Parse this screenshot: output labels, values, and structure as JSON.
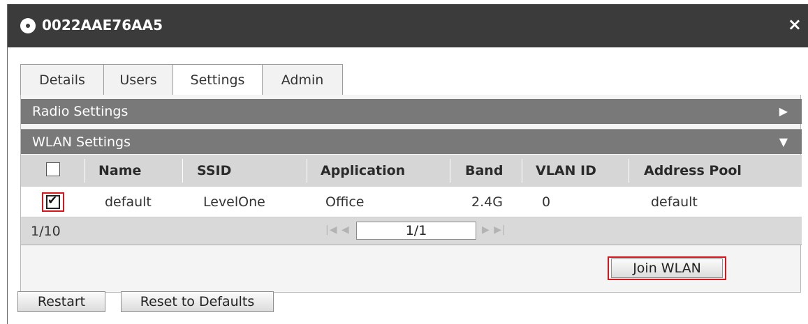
{
  "window": {
    "title": "0022AAE76AA5",
    "icon": "wireless-ap-icon",
    "close_glyph": "×"
  },
  "tabs": [
    {
      "label": "Details"
    },
    {
      "label": "Users"
    },
    {
      "label": "Settings",
      "active": true
    },
    {
      "label": "Admin"
    }
  ],
  "sections": {
    "radio": {
      "label": "Radio Settings",
      "arrow": "▶",
      "expanded": false
    },
    "wlan": {
      "label": "WLAN Settings",
      "arrow": "▼",
      "expanded": true
    }
  },
  "table": {
    "columns": [
      "Name",
      "SSID",
      "Application",
      "Band",
      "VLAN ID",
      "Address Pool"
    ],
    "rows": [
      {
        "checked": true,
        "name": "default",
        "ssid": "LevelOne",
        "application": "Office",
        "band": "2.4G",
        "vlan_id": "0",
        "address_pool": "default"
      }
    ]
  },
  "pager": {
    "count": "1/10",
    "first_prev": "|◀ ◀",
    "page": "1/1",
    "next_last": "▶ ▶|"
  },
  "buttons": {
    "join_wlan": "Join WLAN",
    "restart": "Restart",
    "reset": "Reset to Defaults"
  },
  "colors": {
    "highlight": "#d6161a",
    "titlebar": "#3b3b3b",
    "section_bar": "#797979"
  }
}
